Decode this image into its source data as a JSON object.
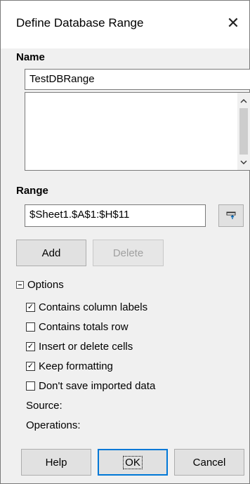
{
  "window": {
    "title": "Define Database Range",
    "close_glyph": "✕"
  },
  "name_section": {
    "label": "Name",
    "value": "TestDBRange",
    "list_items": []
  },
  "range_section": {
    "label": "Range",
    "value": "$Sheet1.$A$1:$H$11"
  },
  "buttons": {
    "add": "Add",
    "delete": "Delete",
    "help": "Help",
    "ok": "OK",
    "cancel": "Cancel"
  },
  "options": {
    "label": "Options",
    "expanded": true,
    "items": [
      {
        "label": "Contains column labels",
        "checked": true
      },
      {
        "label": "Contains totals row",
        "checked": false
      },
      {
        "label": "Insert or delete cells",
        "checked": true
      },
      {
        "label": "Keep formatting",
        "checked": true
      },
      {
        "label": "Don't save imported data",
        "checked": false
      }
    ],
    "source_label": "Source:",
    "operations_label": "Operations:"
  },
  "icons": {
    "close": "close-icon",
    "scroll_up": "chevron-up-icon",
    "scroll_down": "chevron-down-icon",
    "shrink": "shrink-dialog-icon",
    "expander": "collapse-icon",
    "check": "checkmark-icon"
  },
  "colors": {
    "dialog_bg": "#f0f0f0",
    "title_bg": "#ffffff",
    "default_button_border": "#0078d7",
    "shrink_icon": "#0063b1"
  }
}
